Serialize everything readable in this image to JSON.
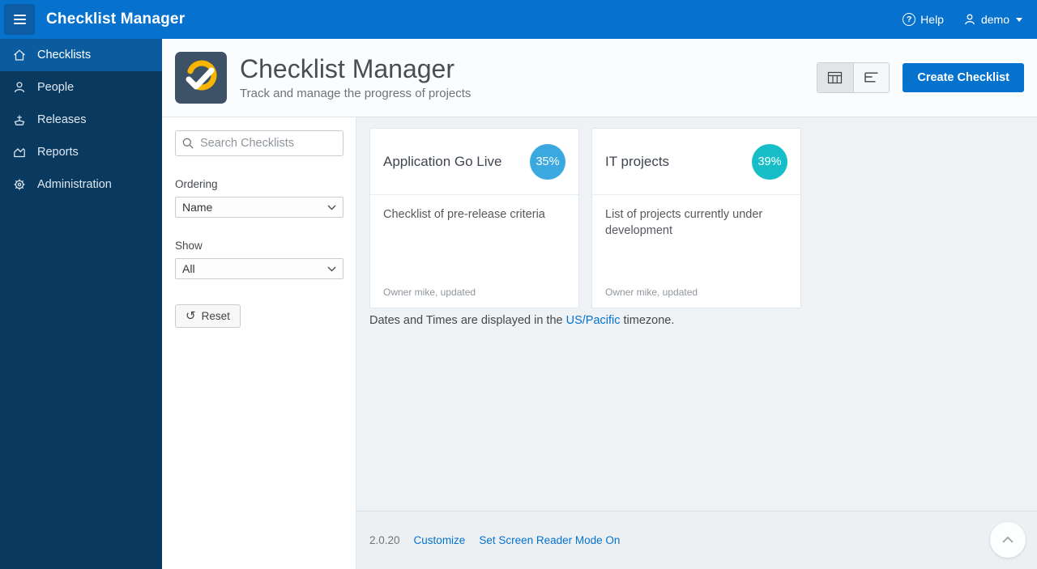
{
  "topbar": {
    "title": "Checklist Manager",
    "help_label": "Help",
    "user_label": "demo"
  },
  "sidebar": {
    "items": [
      {
        "label": "Checklists",
        "icon": "home-icon",
        "active": true
      },
      {
        "label": "People",
        "icon": "person-icon",
        "active": false
      },
      {
        "label": "Releases",
        "icon": "ship-icon",
        "active": false
      },
      {
        "label": "Reports",
        "icon": "chart-icon",
        "active": false
      },
      {
        "label": "Administration",
        "icon": "gear-icon",
        "active": false
      }
    ]
  },
  "page_header": {
    "title": "Checklist Manager",
    "subtitle": "Track and manage the progress of projects",
    "create_button_label": "Create Checklist",
    "active_view": "grid-view"
  },
  "filters": {
    "search_placeholder": "Search Checklists",
    "ordering_label": "Ordering",
    "ordering_value": "Name",
    "show_label": "Show",
    "show_value": "All",
    "reset_label": "Reset"
  },
  "cards": [
    {
      "title": "Application Go Live",
      "percent": "35%",
      "badge_color": "#3BA8DF",
      "description": "Checklist of pre-release criteria",
      "owner_note": "Owner mike, updated"
    },
    {
      "title": "IT projects",
      "percent": "39%",
      "badge_color": "#17BEC7",
      "description": "List of projects currently under development",
      "owner_note": "Owner mike, updated"
    }
  ],
  "timezone_note": {
    "prefix": "Dates and Times are displayed in the ",
    "link_text": "US/Pacific",
    "suffix": " timezone."
  },
  "footer": {
    "version": "2.0.20",
    "customize_label": "Customize",
    "screen_reader_label": "Set Screen Reader Mode On"
  },
  "colors": {
    "topbar_blue": "#0772CE",
    "sidebar_navy": "#0A3960",
    "sidebar_active_blue": "#0B5C9E",
    "accent_blue": "#0572CE",
    "content_bg": "#EEF2F5",
    "badge_blue": "#3BA8DF",
    "badge_teal": "#17BEC7",
    "app_icon_bg": "#3D5266",
    "app_icon_ring_yellow": "#F7B500"
  }
}
